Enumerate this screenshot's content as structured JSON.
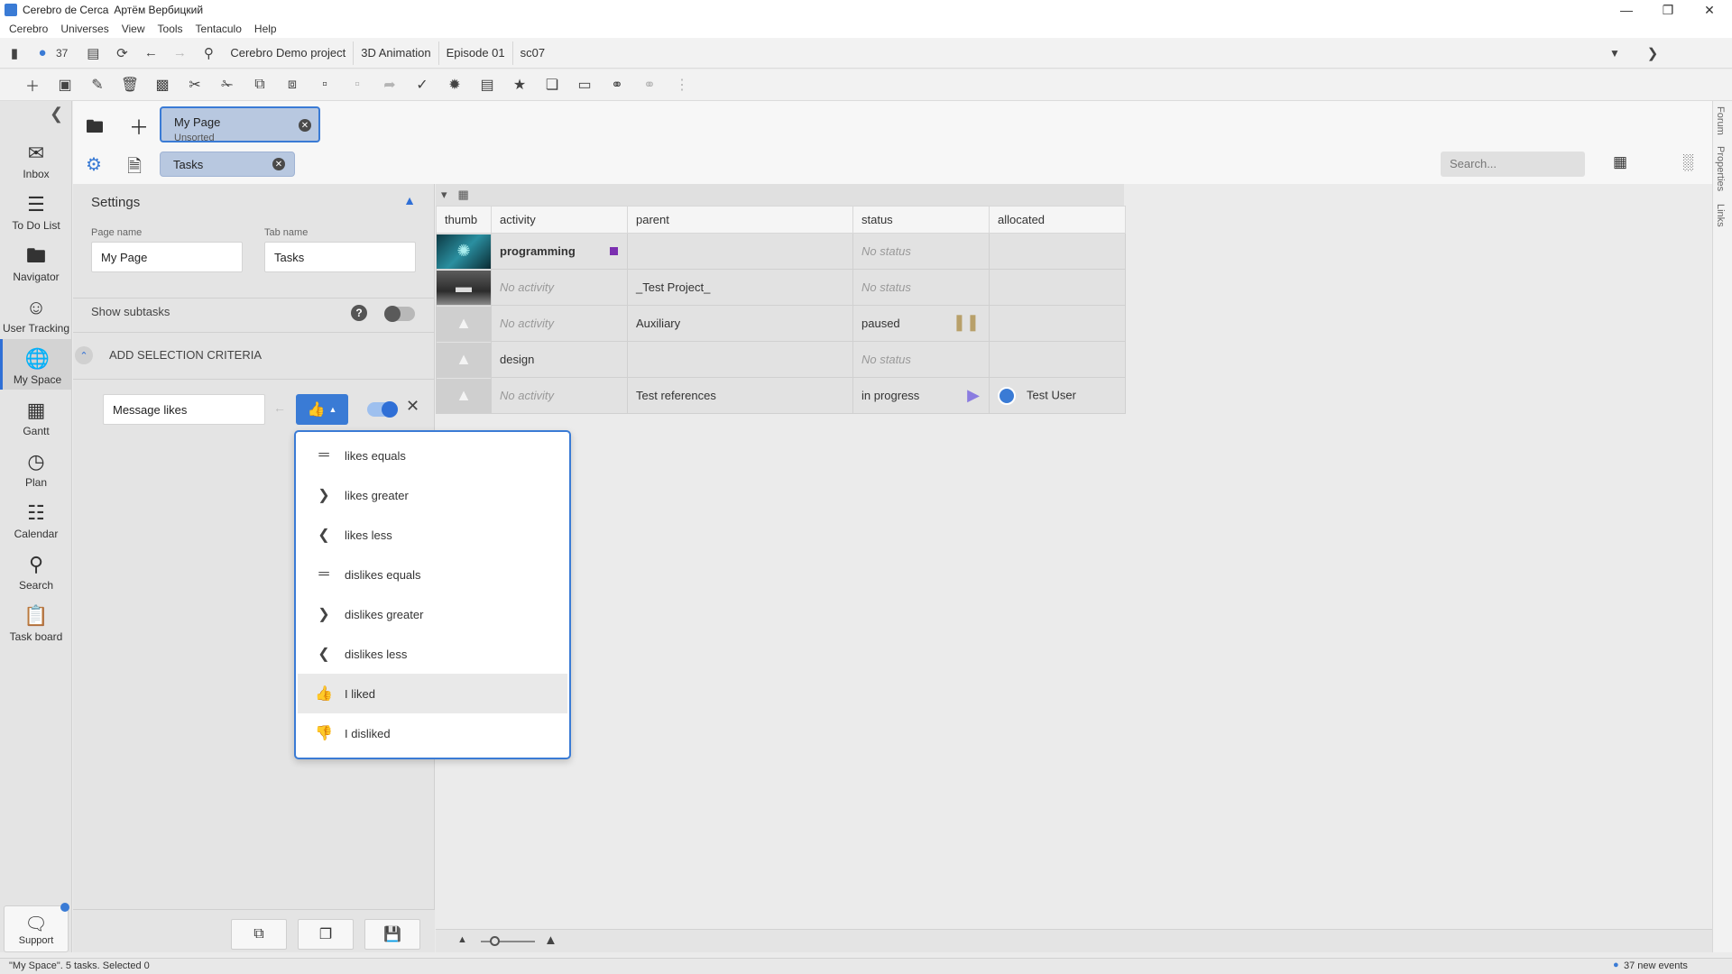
{
  "window": {
    "app": "Cerebro de Cerca",
    "user": "Артём Вербицкий"
  },
  "menu": [
    "Cerebro",
    "Universes",
    "View",
    "Tools",
    "Tentaculo",
    "Help"
  ],
  "navbar": {
    "notif_count": "37",
    "breadcrumbs": [
      "Cerebro Demo project",
      "3D Animation",
      "Episode 01",
      "sc07"
    ]
  },
  "sidebar": {
    "items": [
      {
        "label": "Inbox",
        "icon": "mail-icon"
      },
      {
        "label": "To Do List",
        "icon": "list-icon"
      },
      {
        "label": "Navigator",
        "icon": "folder-icon"
      },
      {
        "label": "User Tracking",
        "icon": "users-icon"
      },
      {
        "label": "My Space",
        "icon": "globe-icon",
        "active": true
      },
      {
        "label": "Gantt",
        "icon": "gantt-icon"
      },
      {
        "label": "Plan",
        "icon": "plan-icon"
      },
      {
        "label": "Calendar",
        "icon": "calendar-icon"
      },
      {
        "label": "Search",
        "icon": "search-icon"
      },
      {
        "label": "Task board",
        "icon": "clipboard-icon"
      }
    ],
    "support": "Support"
  },
  "right_edge": [
    "Forum",
    "Properties",
    "Links"
  ],
  "page": {
    "chip_title": "My Page",
    "chip_sub": "Unsorted",
    "tab_chip": "Tasks",
    "search_placeholder": "Search..."
  },
  "settings": {
    "title": "Settings",
    "page_name_label": "Page name",
    "page_name_value": "My Page",
    "tab_name_label": "Tab name",
    "tab_name_value": "Tasks",
    "show_subtasks": "Show subtasks",
    "add_criteria": "ADD SELECTION CRITERIA",
    "criteria_field": "Message likes"
  },
  "dropdown": {
    "items": [
      {
        "label": "likes equals",
        "icon": "equals-icon"
      },
      {
        "label": "likes greater",
        "icon": "greater-icon"
      },
      {
        "label": "likes less",
        "icon": "less-icon"
      },
      {
        "label": "dislikes equals",
        "icon": "equals-icon"
      },
      {
        "label": "dislikes greater",
        "icon": "greater-icon"
      },
      {
        "label": "dislikes less",
        "icon": "less-icon"
      },
      {
        "label": "I liked",
        "icon": "thumbs-up-icon",
        "highlighted": true
      },
      {
        "label": "I disliked",
        "icon": "thumbs-down-icon"
      }
    ]
  },
  "table": {
    "columns": [
      "thumb",
      "activity",
      "parent",
      "status",
      "allocated"
    ],
    "rows": [
      {
        "activity": "programming",
        "parent": "",
        "status": "No status",
        "allocated": ""
      },
      {
        "activity": "No activity",
        "parent": "_Test Project_",
        "status": "No status",
        "allocated": ""
      },
      {
        "activity": "No activity",
        "parent": "Auxiliary",
        "status": "paused",
        "allocated": ""
      },
      {
        "activity": "design",
        "parent": "",
        "status": "No status",
        "allocated": ""
      },
      {
        "activity": "No activity",
        "parent": "Test references",
        "status": "in progress",
        "allocated": "Test User"
      }
    ]
  },
  "statusbar": {
    "left": "\"My Space\". 5 tasks. Selected 0",
    "right": "37 new events"
  },
  "colors": {
    "accent": "#3a7bd5",
    "paused": "#b8a06a",
    "in_progress": "#8a7ce0",
    "programming_mark": "#7b2fb0"
  }
}
